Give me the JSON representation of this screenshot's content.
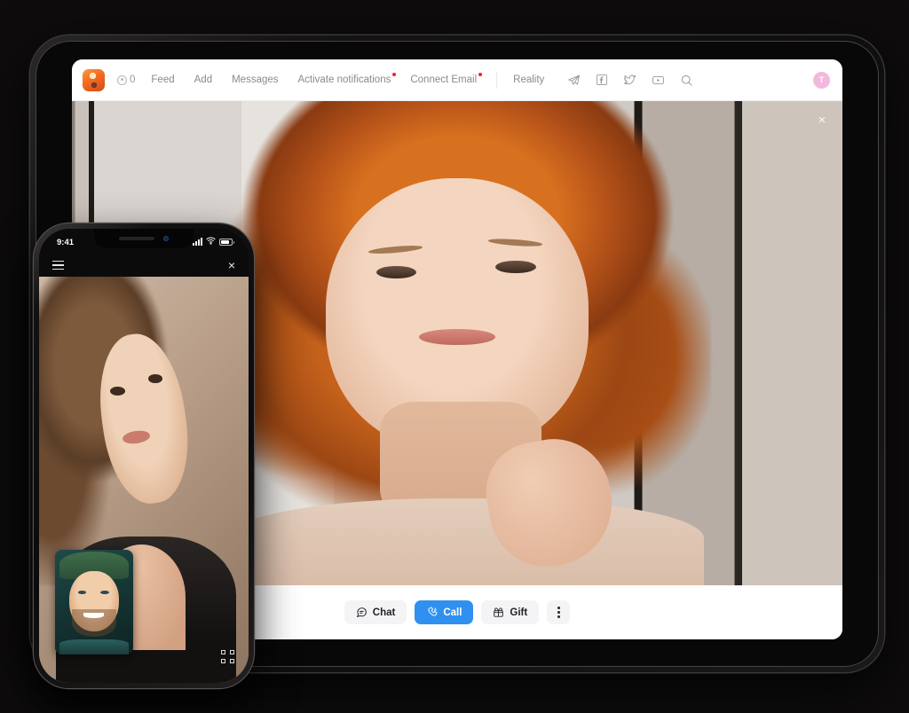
{
  "tablet": {
    "navbar": {
      "logo_name": "app-logo",
      "coin_icon": "coin-icon",
      "coin_count": "0",
      "links": [
        {
          "label": "Feed",
          "badge": false
        },
        {
          "label": "Add",
          "badge": false
        },
        {
          "label": "Messages",
          "badge": false
        },
        {
          "label": "Activate notifications",
          "badge": true
        },
        {
          "label": "Connect Email",
          "badge": true
        }
      ],
      "secondary_link": "Reality",
      "social_icons": [
        "telegram-icon",
        "facebook-icon",
        "twitter-icon",
        "youtube-icon",
        "search-icon"
      ],
      "avatar_initial": "T",
      "avatar_color": "#f2b8dd",
      "badge_color": "#f5202a"
    },
    "photo": {
      "alt_name": "profile-photo-redhead-woman",
      "close_label": "×"
    },
    "actions": [
      {
        "label": "Chat",
        "icon": "chat-bubble-icon",
        "primary": false
      },
      {
        "label": "Call",
        "icon": "phone-call-icon",
        "primary": true
      },
      {
        "label": "Gift",
        "icon": "gift-box-icon",
        "primary": false
      }
    ],
    "more_menu_icon": "more-vertical-icon",
    "primary_color": "#3090f0"
  },
  "phone": {
    "status_bar": {
      "time": "9:41",
      "signal_icon": "cellular-signal-icon",
      "wifi_icon": "wifi-icon",
      "battery_icon": "battery-icon"
    },
    "topbar": {
      "menu_icon": "hamburger-menu-icon",
      "close_label": "×"
    },
    "video": {
      "main_name": "video-call-remote-woman",
      "pip_name": "video-call-self-man"
    },
    "fullscreen_icon": "fullscreen-expand-icon"
  }
}
